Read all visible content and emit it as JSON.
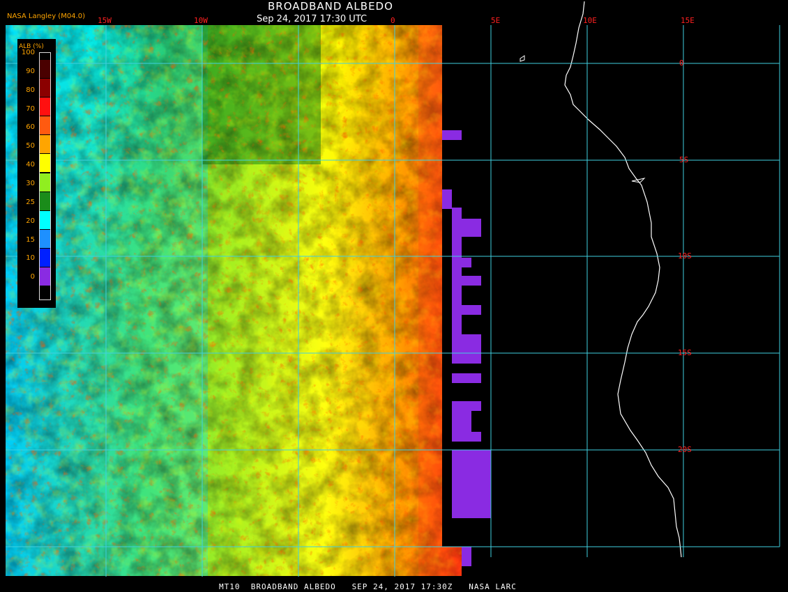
{
  "header": {
    "title": "BROADBAND ALBEDO",
    "subtitle": "Sep 24, 2017 17:30 UTC",
    "source": "NASA Langley (M04.0)"
  },
  "footer": "MT10  BROADBAND ALBEDO   SEP 24, 2017 17:30Z   NASA LARC",
  "grid": {
    "longitude_labels": [
      "15W",
      "10W",
      "0",
      "5E",
      "10E",
      "15E"
    ],
    "latitude_labels": [
      "0",
      "5S",
      "10S",
      "15S",
      "20S"
    ],
    "line_color": "#40d0e0",
    "label_color": "#ff2020"
  },
  "legend": {
    "title": "ALB (%)",
    "levels": [
      {
        "label": "100",
        "color": "#4a0000"
      },
      {
        "label": "90",
        "color": "#8b0000"
      },
      {
        "label": "80",
        "color": "#ff1010"
      },
      {
        "label": "70",
        "color": "#ff5a10"
      },
      {
        "label": "60",
        "color": "#ffa500"
      },
      {
        "label": "50",
        "color": "#ffff00"
      },
      {
        "label": "40",
        "color": "#90ee20"
      },
      {
        "label": "30",
        "color": "#1a8c1a"
      },
      {
        "label": "25",
        "color": "#00ffff"
      },
      {
        "label": "20",
        "color": "#1e90ff"
      },
      {
        "label": "15",
        "color": "#0020ff"
      },
      {
        "label": "10",
        "color": "#8a2be2"
      },
      {
        "label": "0",
        "color": ""
      }
    ]
  },
  "colors": {
    "background": "#000000",
    "coastline": "#ffffff",
    "no_data_block": "#8a2be2"
  }
}
